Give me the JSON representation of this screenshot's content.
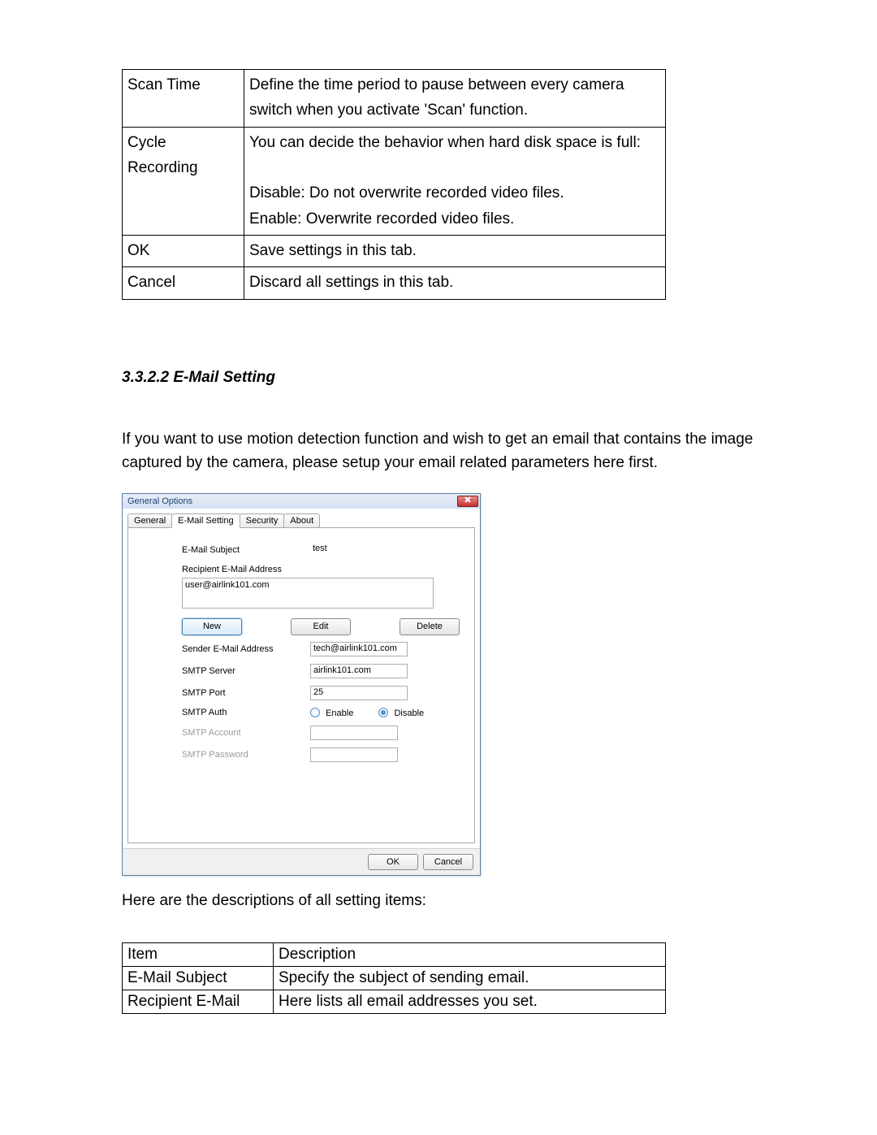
{
  "top_table": {
    "rows": [
      {
        "item": "Scan Time",
        "desc": "Define the time period to pause between every camera switch when you activate 'Scan' function."
      },
      {
        "item": "Cycle Recording",
        "desc": "You can decide the behavior when hard disk space is full:\n\nDisable: Do not overwrite recorded video files.\nEnable: Overwrite recorded video files."
      },
      {
        "item": "OK",
        "desc": "Save settings in this tab."
      },
      {
        "item": "Cancel",
        "desc": "Discard all settings in this tab."
      }
    ]
  },
  "heading": "3.3.2.2 E-Mail Setting",
  "intro": "If you want to use motion detection function and wish to get an email that contains the image captured by the camera, please setup your email related parameters here first.",
  "dialog": {
    "title": "General Options",
    "tabs": [
      "General",
      "E-Mail Setting",
      "Security",
      "About"
    ],
    "active_tab": "E-Mail Setting",
    "labels": {
      "subject": "E-Mail Subject",
      "recipient": "Recipient E-Mail Address",
      "sender": "Sender E-Mail Address",
      "server": "SMTP Server",
      "port": "SMTP Port",
      "auth": "SMTP Auth",
      "account": "SMTP Account",
      "password": "SMTP Password"
    },
    "values": {
      "subject": "test",
      "recipient": "user@airlink101.com",
      "sender": "tech@airlink101.com",
      "server": "airlink101.com",
      "port": "25",
      "account": "",
      "password": ""
    },
    "auth_enable": "Enable",
    "auth_disable": "Disable",
    "buttons": {
      "new": "New",
      "edit": "Edit",
      "delete": "Delete"
    },
    "footer": {
      "ok": "OK",
      "cancel": "Cancel"
    }
  },
  "after_dlg": "Here are the descriptions of all setting items:",
  "desc_table": {
    "head_item": "Item",
    "head_desc": "Description",
    "rows": [
      {
        "item": "E-Mail Subject",
        "desc": "Specify the subject of sending email."
      },
      {
        "item": "Recipient E-Mail",
        "desc": "Here lists all email addresses you set."
      }
    ]
  }
}
